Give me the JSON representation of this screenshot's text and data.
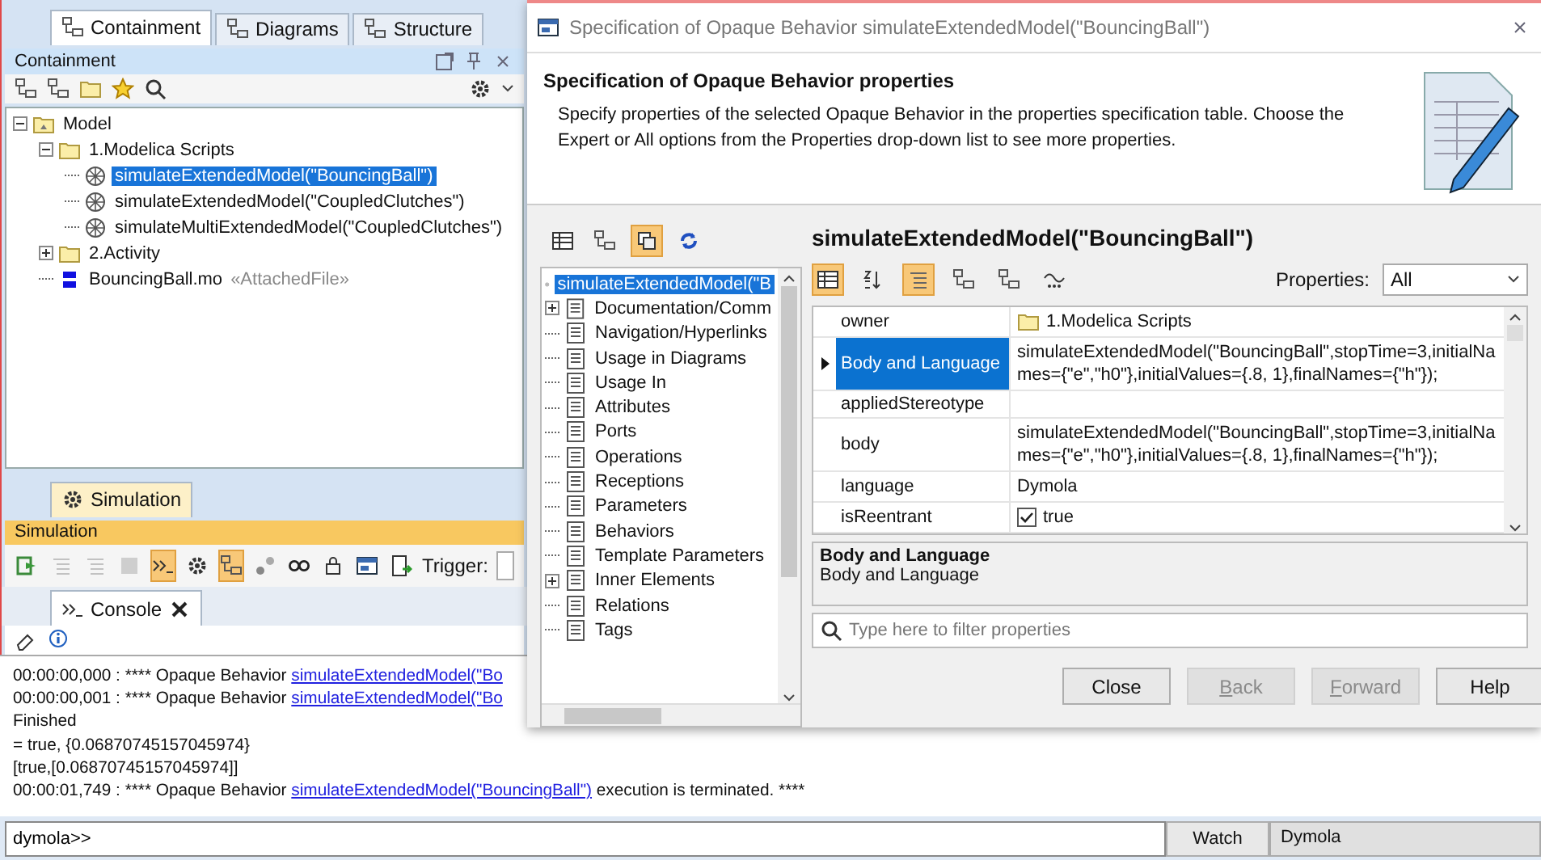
{
  "browser": {
    "tabs": [
      {
        "label": "Containment",
        "selected": true
      },
      {
        "label": "Diagrams",
        "selected": false
      },
      {
        "label": "Structure",
        "selected": false
      }
    ],
    "panel_title": "Containment",
    "tree": [
      {
        "label": "Model",
        "kind": "model",
        "expanded": true,
        "selected": false,
        "children": [
          {
            "label": "1.Modelica Scripts",
            "kind": "package",
            "expanded": true,
            "selected": false,
            "children": [
              {
                "label": "simulateExtendedModel(\"BouncingBall\")",
                "kind": "behavior",
                "selected": true
              },
              {
                "label": "simulateExtendedModel(\"CoupledClutches\")",
                "kind": "behavior",
                "selected": false
              },
              {
                "label": "simulateMultiExtendedModel(\"CoupledClutches\")",
                "kind": "behavior",
                "selected": false
              }
            ]
          },
          {
            "label": "2.Activity",
            "kind": "package",
            "expanded": false,
            "selected": false
          },
          {
            "label": "BouncingBall.mo",
            "kind": "file",
            "selected": false,
            "stereotype": "«AttachedFile»"
          }
        ]
      }
    ]
  },
  "simulation": {
    "tab": "Simulation",
    "title": "Simulation",
    "trigger_label": "Trigger:",
    "toolbar": [
      {
        "pressed": false,
        "disabled": false
      },
      {
        "pressed": false,
        "disabled": true
      },
      {
        "pressed": false,
        "disabled": true
      },
      {
        "pressed": false,
        "disabled": true
      },
      {
        "pressed": true,
        "disabled": false
      },
      {
        "pressed": false,
        "disabled": false
      },
      {
        "pressed": true,
        "disabled": false
      },
      {
        "pressed": false,
        "disabled": false
      },
      {
        "pressed": false,
        "disabled": false
      },
      {
        "pressed": false,
        "disabled": false
      },
      {
        "pressed": false,
        "disabled": false
      },
      {
        "pressed": false,
        "disabled": false
      }
    ]
  },
  "console": {
    "tab": "Console",
    "lines": [
      [
        {
          "text": "00:00:00,000 : **** Opaque Behavior "
        },
        {
          "text": "simulateExtendedModel(\"Bo",
          "link": true
        }
      ],
      [
        {
          "text": "00:00:00,001 : **** Opaque Behavior "
        },
        {
          "text": "simulateExtendedModel(\"Bo",
          "link": true
        }
      ],
      [
        {
          "text": "Finished"
        }
      ],
      [
        {
          "text": "= true, {0.06870745157045974}"
        }
      ],
      [
        {
          "text": "[true,[0.06870745157045974]]"
        }
      ],
      [
        {
          "text": "00:00:01,749 : **** Opaque Behavior "
        },
        {
          "text": "simulateExtendedModel(\"BouncingBall\")",
          "link": true
        },
        {
          "text": " execution is terminated. ****"
        }
      ]
    ]
  },
  "command": {
    "value": "dymola>>",
    "watch_button": "Watch",
    "engine": "Dymola"
  },
  "dialog": {
    "title": "Specification of Opaque Behavior simulateExtendedModel(\"BouncingBall\")",
    "header_title": "Specification of Opaque Behavior properties",
    "header_description": "Specify properties of the selected Opaque Behavior in the properties specification table. Choose the Expert or All options from the Properties drop-down list to see more properties.",
    "left_toolbar": [
      {
        "pressed": false
      },
      {
        "pressed": false
      },
      {
        "pressed": true
      },
      {
        "pressed": false
      }
    ],
    "nav": [
      {
        "label": "simulateExtendedModel(\"B",
        "kind": "behavior",
        "selected": true
      },
      {
        "label": "Documentation/Comm",
        "kind": "page",
        "selected": false,
        "expanded": false
      },
      {
        "label": "Navigation/Hyperlinks",
        "kind": "page",
        "selected": false
      },
      {
        "label": "Usage in Diagrams",
        "kind": "page",
        "selected": false
      },
      {
        "label": "Usage In",
        "kind": "page",
        "selected": false
      },
      {
        "label": "Attributes",
        "kind": "page",
        "selected": false
      },
      {
        "label": "Ports",
        "kind": "page",
        "selected": false
      },
      {
        "label": "Operations",
        "kind": "page",
        "selected": false
      },
      {
        "label": "Receptions",
        "kind": "page",
        "selected": false
      },
      {
        "label": "Parameters",
        "kind": "page",
        "selected": false
      },
      {
        "label": "Behaviors",
        "kind": "page",
        "selected": false
      },
      {
        "label": "Template Parameters",
        "kind": "page",
        "selected": false
      },
      {
        "label": "Inner Elements",
        "kind": "page",
        "selected": false,
        "expanded": false
      },
      {
        "label": "Relations",
        "kind": "page",
        "selected": false
      },
      {
        "label": "Tags",
        "kind": "page",
        "selected": false
      }
    ],
    "element_title": "simulateExtendedModel(\"BouncingBall\")",
    "grid_toolbar": [
      {
        "pressed": true
      },
      {
        "pressed": false
      },
      {
        "pressed": true
      },
      {
        "pressed": false
      },
      {
        "pressed": false
      },
      {
        "pressed": false
      }
    ],
    "properties_label": "Properties:",
    "properties_value": "All",
    "rows": [
      {
        "name": "owner",
        "kind": "package",
        "value": "1.Modelica Scripts",
        "selected": false
      },
      {
        "name": "Body and Language",
        "kind": "text",
        "value": "simulateExtendedModel(\"BouncingBall\",stopTime=3,initialNames={\"e\",\"h0\"},initialValues={.8, 1},finalNames={\"h\"});",
        "selected": true
      },
      {
        "name": "appliedStereotype",
        "kind": "text",
        "selected": false
      },
      {
        "name": "body",
        "kind": "text",
        "value": "simulateExtendedModel(\"BouncingBall\",stopTime=3,initialNames={\"e\",\"h0\"},initialValues={.8, 1},finalNames={\"h\"});",
        "selected": false
      },
      {
        "name": "language",
        "kind": "text",
        "value": "Dymola",
        "selected": false
      },
      {
        "name": "isReentrant",
        "kind": "checkbox",
        "value": "true",
        "checked": true,
        "selected": false
      }
    ],
    "description_title": "Body and Language",
    "description_text": "Body and Language",
    "filter_placeholder": "Type here to filter properties",
    "buttons": [
      {
        "label": "Close",
        "disabled": false,
        "mnemonic": false
      },
      {
        "label": "Back",
        "disabled": true,
        "mnemonic": true
      },
      {
        "label": "Forward",
        "disabled": true,
        "mnemonic": true
      },
      {
        "label": "Help",
        "disabled": false,
        "mnemonic": false
      }
    ]
  }
}
